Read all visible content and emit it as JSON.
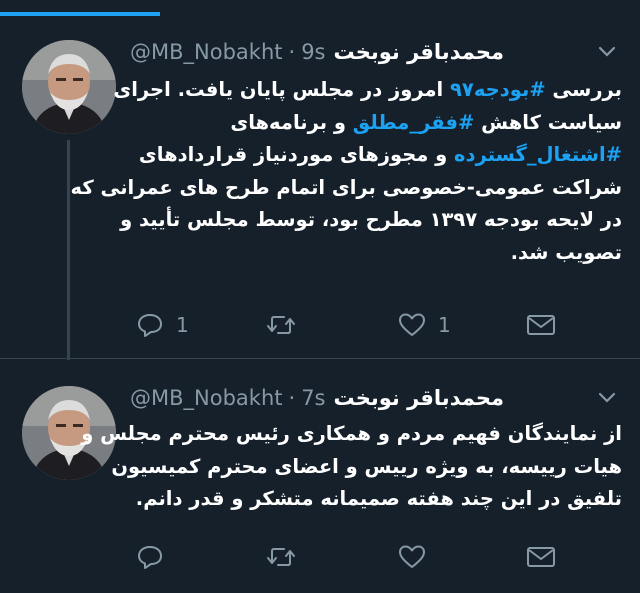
{
  "colors": {
    "background": "#15202b",
    "accent": "#1da1f2",
    "muted": "#8899a6",
    "divider": "#38444d",
    "text": "#ffffff"
  },
  "progress": 0.25,
  "tweets": [
    {
      "name": "محمدباقر نوبخت",
      "handle": "@MB_Nobakht",
      "separator": "·",
      "time": "9s",
      "menu_icon": "chevron-down-icon",
      "lines": [
        {
          "segments": [
            {
              "text": "بررسی "
            },
            {
              "text": "#بودجه۹۷",
              "hashtag": true
            },
            {
              "text": " امروز در مجلس پایان یافت. اجرای"
            }
          ]
        },
        {
          "segments": [
            {
              "text": "سیاست کاهش "
            },
            {
              "text": "#فقر_مطلق",
              "hashtag": true
            },
            {
              "text": " و برنامه‌های"
            }
          ]
        },
        {
          "segments": [
            {
              "text": "#اشتغال_گسترده",
              "hashtag": true
            },
            {
              "text": " و مجوزهای موردنیاز قراردادهای"
            }
          ]
        },
        {
          "segments": [
            {
              "text": "شراکت عمومی-خصوصی برای اتمام طرح های عمرانی که"
            }
          ]
        },
        {
          "segments": [
            {
              "text": "در لایحه بودجه ۱۳۹۷ مطرح بود، توسط مجلس تأیید و"
            }
          ]
        },
        {
          "segments": [
            {
              "text": "تصویب شد."
            }
          ]
        }
      ],
      "actions": {
        "reply_count": "1",
        "retweet_count": "",
        "like_count": "1"
      }
    },
    {
      "name": "محمدباقر نوبخت",
      "handle": "@MB_Nobakht",
      "separator": "·",
      "time": "7s",
      "menu_icon": "chevron-down-icon",
      "lines": [
        {
          "segments": [
            {
              "text": "از نمایندگان فهیم مردم و همکاری رئیس محترم مجلس و"
            }
          ]
        },
        {
          "segments": [
            {
              "text": "هیات رییسه، به ویژه رییس و اعضای محترم کمیسیون"
            }
          ]
        },
        {
          "segments": [
            {
              "text": "تلفیق در این چند هفته صمیمانه متشکر و قدر دانم."
            }
          ]
        }
      ],
      "actions": {
        "reply_count": "",
        "retweet_count": "",
        "like_count": ""
      }
    }
  ]
}
